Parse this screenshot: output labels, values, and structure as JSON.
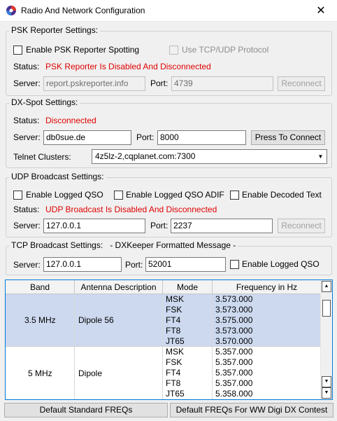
{
  "window": {
    "title": "Radio And Network Configuration"
  },
  "psk": {
    "legend": "PSK Reporter Settings:",
    "enable_label": "Enable PSK Reporter Spotting",
    "tcp_label": "Use TCP/UDP Protocol",
    "status_label": "Status:",
    "status_value": "PSK Reporter Is Disabled And Disconnected",
    "server_label": "Server:",
    "server_value": "report.pskreporter.info",
    "port_label": "Port:",
    "port_value": "4739",
    "reconnect_label": "Reconnect"
  },
  "dx": {
    "legend": "DX-Spot Settings:",
    "status_label": "Status:",
    "status_value": "Disconnected",
    "server_label": "Server:",
    "server_value": "db0sue.de",
    "port_label": "Port:",
    "port_value": "8000",
    "connect_label": "Press To Connect",
    "telnet_label": "Telnet Clusters:",
    "telnet_value": "4z5lz-2,cqplanet.com:7300"
  },
  "udp": {
    "legend": "UDP Broadcast Settings:",
    "cb1": "Enable Logged QSO",
    "cb2": "Enable Logged QSO ADIF",
    "cb3": "Enable Decoded Text",
    "status_label": "Status:",
    "status_value": "UDP Broadcast Is Disabled And Disconnected",
    "server_label": "Server:",
    "server_value": "127.0.0.1",
    "port_label": "Port:",
    "port_value": "2237",
    "reconnect_label": "Reconnect"
  },
  "tcp": {
    "legend": "TCP Broadcast Settings:",
    "note": "- DXKeeper Formatted Message -",
    "server_label": "Server:",
    "server_value": "127.0.0.1",
    "port_label": "Port:",
    "port_value": "52001",
    "cb_label": "Enable Logged QSO"
  },
  "table": {
    "headers": [
      "Band",
      "Antenna Description",
      "Mode",
      "Frequency in Hz"
    ],
    "rows": [
      {
        "band": "3.5 MHz",
        "antenna": "Dipole 56",
        "modes": [
          "MSK",
          "FSK",
          "FT4",
          "FT8",
          "JT65"
        ],
        "freqs": [
          "3.573.000",
          "3.573.000",
          "3.575.000",
          "3.573.000",
          "3.570.000"
        ]
      },
      {
        "band": "5 MHz",
        "antenna": "Dipole",
        "modes": [
          "MSK",
          "FSK",
          "FT4",
          "FT8",
          "JT65"
        ],
        "freqs": [
          "5.357.000",
          "5.357.000",
          "5.357.000",
          "5.357.000",
          "5.358.000"
        ]
      }
    ]
  },
  "buttons": {
    "default_std": "Default Standard FREQs",
    "default_ww": "Default FREQs For WW Digi DX Contest"
  },
  "colors": {
    "status_red": "#e00000",
    "selection": "#ccd9ef",
    "focus_border": "#0078d7"
  }
}
